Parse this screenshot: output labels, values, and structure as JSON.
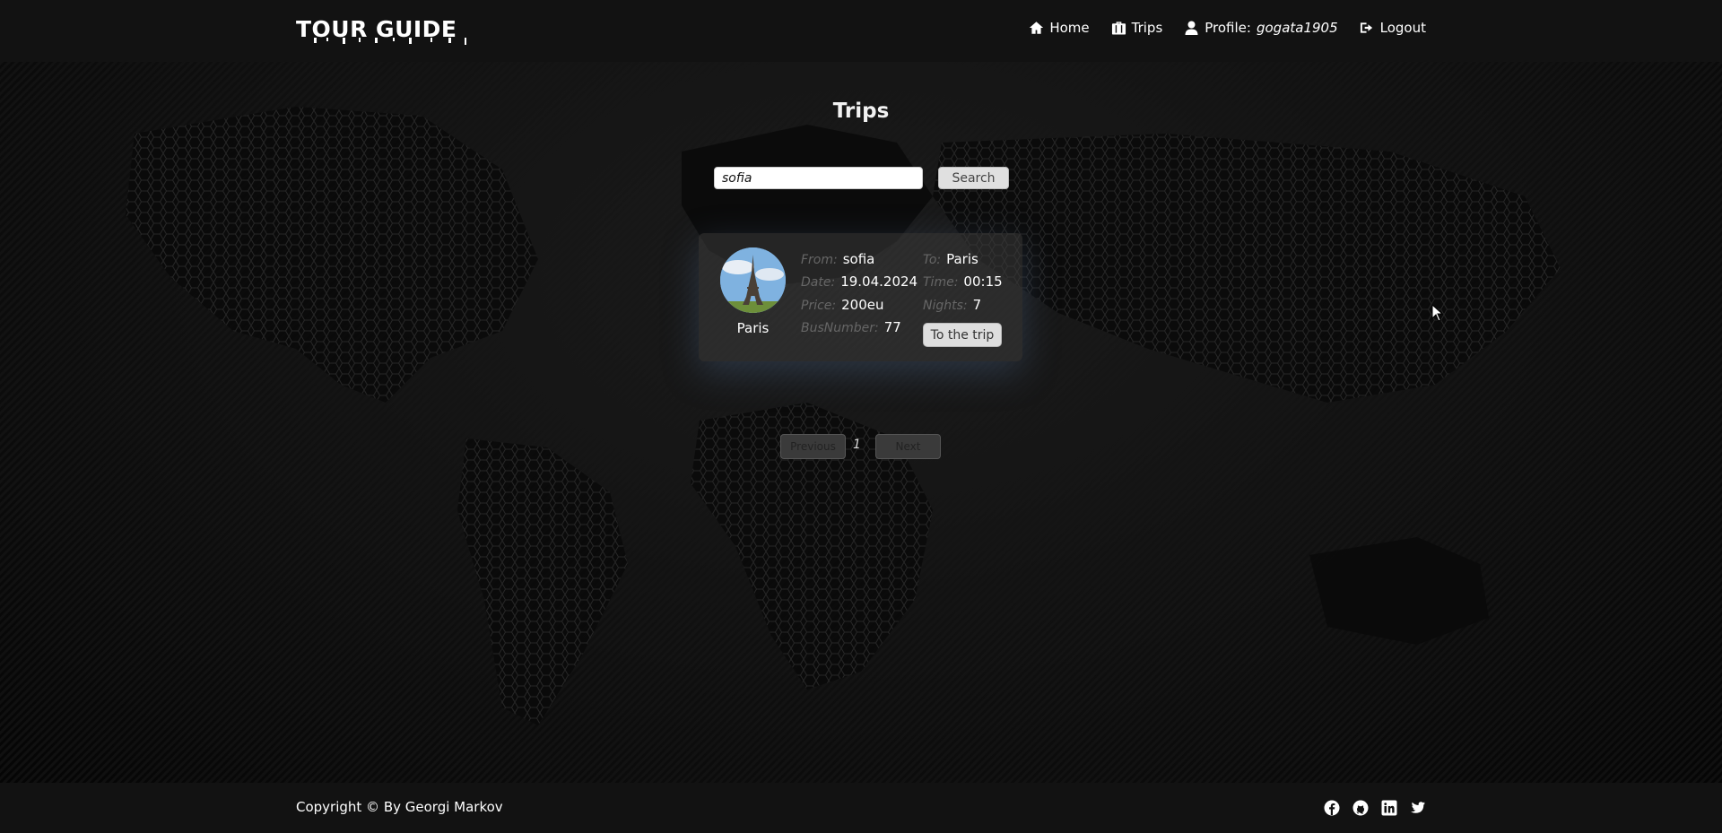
{
  "header": {
    "logo": "TOUR GUIDE",
    "nav": {
      "home": "Home",
      "trips": "Trips",
      "profile_prefix": "Profile:",
      "profile_user": "gogata1905",
      "logout": "Logout"
    }
  },
  "page": {
    "title": "Trips"
  },
  "search": {
    "value": "sofia",
    "button": "Search"
  },
  "trip_card": {
    "image_label": "Paris",
    "fields": {
      "from_label": "From:",
      "from_value": "sofia",
      "to_label": "To:",
      "to_value": "Paris",
      "date_label": "Date:",
      "date_value": "19.04.2024",
      "time_label": "Time:",
      "time_value": "00:15",
      "price_label": "Price:",
      "price_value": "200eu",
      "nights_label": "Nights:",
      "nights_value": "7",
      "bus_label": "BusNumber:",
      "bus_value": "77"
    },
    "button": "To the trip"
  },
  "pagination": {
    "previous": "Previous",
    "current": "1",
    "next": "Next"
  },
  "footer": {
    "copyright": "Copyright © By Georgi Markov",
    "social_icons": [
      "facebook-icon",
      "github-icon",
      "linkedin-icon",
      "twitter-icon"
    ]
  },
  "colors": {
    "header_bg": "#121212",
    "page_bg": "#0b0b0b",
    "card_bg": "#3c3c3c"
  }
}
